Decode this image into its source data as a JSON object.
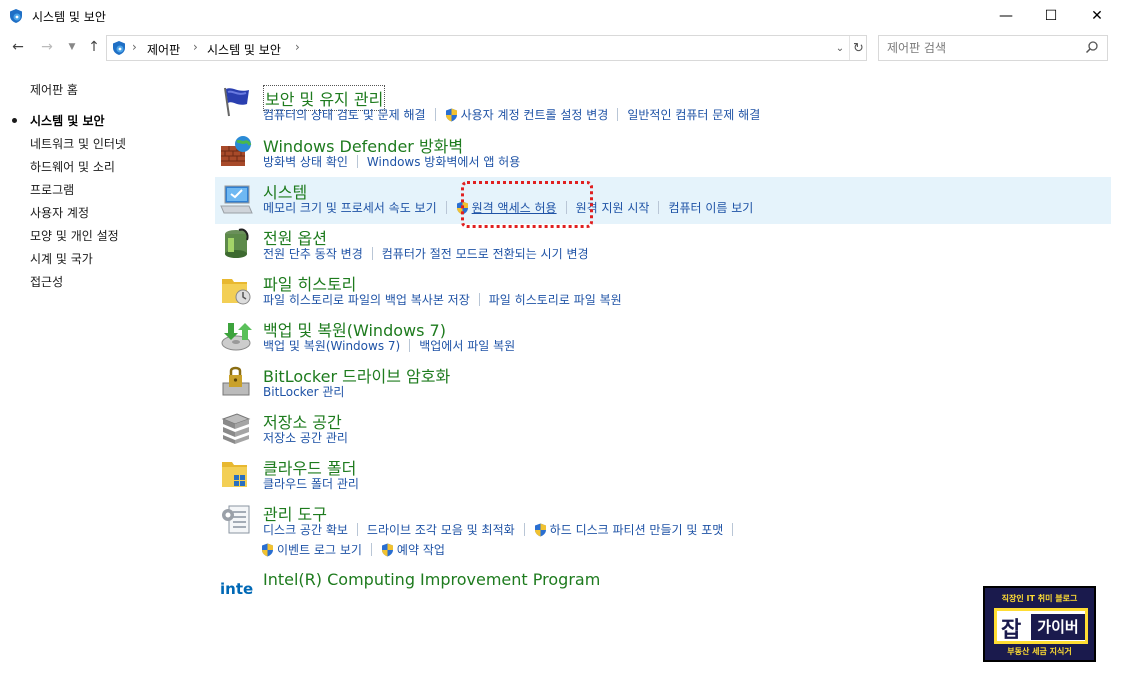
{
  "window": {
    "title": "시스템 및 보안",
    "minimize_glyph": "—",
    "maximize_glyph": "☐",
    "close_glyph": "✕"
  },
  "nav": {
    "breadcrumb": [
      "제어판",
      "시스템 및 보안"
    ],
    "search_placeholder": "제어판 검색"
  },
  "sidebar": {
    "items": [
      {
        "label": "제어판 홈"
      },
      {
        "label": "시스템 및 보안"
      },
      {
        "label": "네트워크 및 인터넷"
      },
      {
        "label": "하드웨어 및 소리"
      },
      {
        "label": "프로그램"
      },
      {
        "label": "사용자 계정"
      },
      {
        "label": "모양 및 개인 설정"
      },
      {
        "label": "시계 및 국가"
      },
      {
        "label": "접근성"
      }
    ]
  },
  "categories": [
    {
      "title": "보안 및 유지 관리",
      "icon": "flag-icon",
      "links": [
        {
          "label": "컴퓨터의 상태 검토 및 문제 해결"
        },
        {
          "label": "사용자 계정 컨트롤 설정 변경"
        },
        {
          "label": "일반적인 컴퓨터 문제 해결"
        }
      ]
    },
    {
      "title": "Windows Defender 방화벽",
      "icon": "firewall-icon",
      "links": [
        {
          "label": "방화벽 상태 확인"
        },
        {
          "label": "Windows 방화벽에서 앱 허용"
        }
      ]
    },
    {
      "title": "시스템",
      "icon": "computer-icon",
      "links": [
        {
          "label": "메모리 크기 및 프로세서 속도 보기"
        },
        {
          "label": "원격 액세스 허용"
        },
        {
          "label": "원격 지원 시작"
        },
        {
          "label": "컴퓨터 이름 보기"
        }
      ]
    },
    {
      "title": "전원 옵션",
      "icon": "battery-icon",
      "links": [
        {
          "label": "전원 단추 동작 변경"
        },
        {
          "label": "컴퓨터가 절전 모드로 전환되는 시기 변경"
        }
      ]
    },
    {
      "title": "파일 히스토리",
      "icon": "file-history-icon",
      "links": [
        {
          "label": "파일 히스토리로 파일의 백업 복사본 저장"
        },
        {
          "label": "파일 히스토리로 파일 복원"
        }
      ]
    },
    {
      "title": "백업 및 복원(Windows 7)",
      "icon": "backup-icon",
      "links": [
        {
          "label": "백업 및 복원(Windows 7)"
        },
        {
          "label": "백업에서 파일 복원"
        }
      ]
    },
    {
      "title": "BitLocker 드라이브 암호화",
      "icon": "bitlocker-icon",
      "links": [
        {
          "label": "BitLocker 관리"
        }
      ]
    },
    {
      "title": "저장소 공간",
      "icon": "storage-icon",
      "links": [
        {
          "label": "저장소 공간 관리"
        }
      ]
    },
    {
      "title": "클라우드 폴더",
      "icon": "cloud-folder-icon",
      "links": [
        {
          "label": "클라우드 폴더 관리"
        }
      ]
    },
    {
      "title": "관리 도구",
      "icon": "admin-tools-icon",
      "links": [
        {
          "label": "디스크 공간 확보"
        },
        {
          "label": "드라이브 조각 모음 및 최적화"
        },
        {
          "label": "하드 디스크 파티션 만들기 및 포맷"
        },
        {
          "label": "이벤트 로그 보기"
        },
        {
          "label": "예약 작업"
        }
      ]
    },
    {
      "title": "Intel(R) Computing Improvement Program",
      "icon": "intel-logo-icon",
      "logo_text": "intel",
      "links": []
    }
  ],
  "watermark": {
    "top": "직장인 IT 취미 블로그",
    "brand_left": "잡",
    "brand_right": "가이버",
    "bottom": "부동산 세금 지식거"
  }
}
